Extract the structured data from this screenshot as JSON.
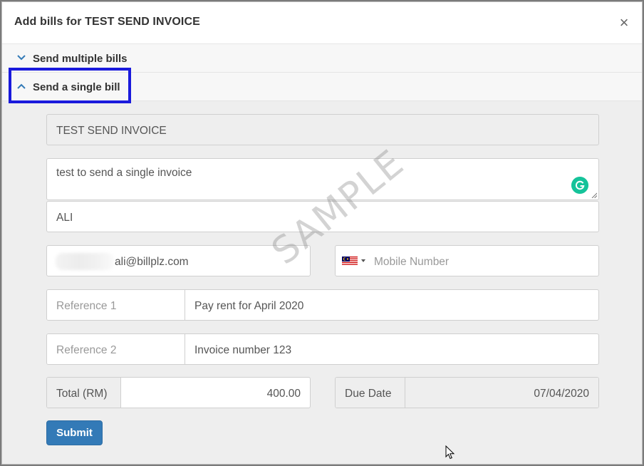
{
  "modal": {
    "title": "Add bills for TEST SEND INVOICE",
    "close_symbol": "×"
  },
  "accordion": {
    "multiple_label": "Send multiple bills",
    "single_label": "Send a single bill"
  },
  "form": {
    "collection_name": "TEST SEND INVOICE",
    "description": "test to send a single invoice",
    "name": "ALI",
    "email": "ali@billplz.com",
    "mobile_placeholder": "Mobile Number",
    "reference1": {
      "label": "Reference 1",
      "value": "Pay rent for April 2020"
    },
    "reference2": {
      "label": "Reference 2",
      "value": "Invoice number 123"
    },
    "total": {
      "label": "Total (RM)",
      "value": "400.00"
    },
    "due_date": {
      "label": "Due Date",
      "value": "07/04/2020"
    },
    "submit_label": "Submit"
  },
  "watermark": "SAMPLE",
  "colors": {
    "highlight": "#1a1adc",
    "primary": "#337ab7",
    "grammarly": "#15c39a"
  }
}
